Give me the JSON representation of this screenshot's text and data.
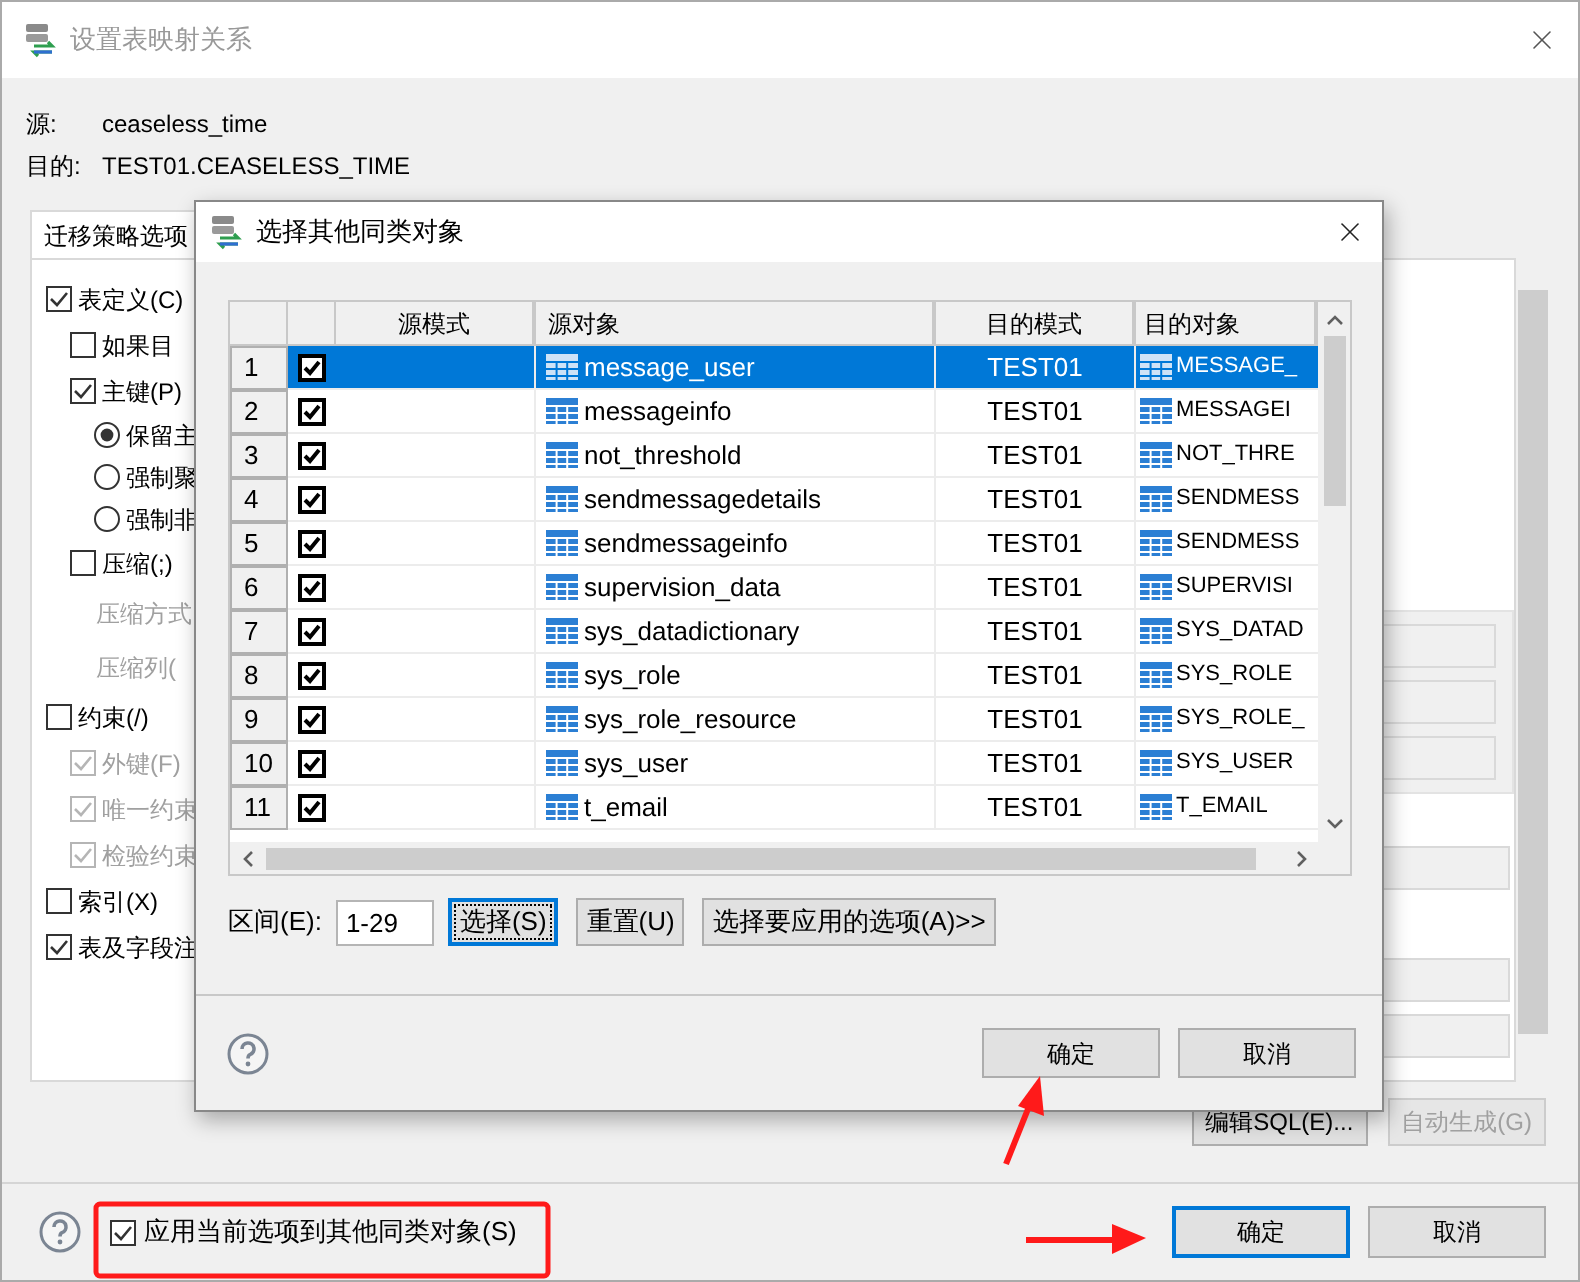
{
  "main_window": {
    "title": "设置表映射关系",
    "source_label": "源:",
    "source_value": "ceaseless_time",
    "target_label": "目的:",
    "target_value": "TEST01.CEASELESS_TIME",
    "tab": {
      "label": "迁移策略选项",
      "selected": true
    },
    "options": [
      {
        "kind": "checkbox",
        "label": "表定义(C)",
        "checked": true,
        "disabled": false,
        "children": [
          {
            "kind": "checkbox",
            "label": "如果目",
            "checked": false,
            "disabled": false
          },
          {
            "kind": "checkbox",
            "label": "主键(P)",
            "checked": true,
            "disabled": false,
            "children": [
              {
                "kind": "radio",
                "label": "保留主",
                "selected": true
              },
              {
                "kind": "radio",
                "label": "强制聚",
                "selected": false
              },
              {
                "kind": "radio",
                "label": "强制非",
                "selected": false
              }
            ]
          },
          {
            "kind": "checkbox",
            "label": "压缩(;)",
            "checked": false,
            "disabled": false,
            "children": [
              {
                "kind": "label",
                "label": "压缩方式",
                "disabled": true
              },
              {
                "kind": "label",
                "label": "压缩列(",
                "disabled": true
              }
            ]
          }
        ]
      },
      {
        "kind": "checkbox",
        "label": "约束(/)",
        "checked": false,
        "disabled": false,
        "children": [
          {
            "kind": "checkbox",
            "label": "外键(F)",
            "checked": true,
            "disabled": true
          },
          {
            "kind": "checkbox",
            "label": "唯一约束",
            "checked": true,
            "disabled": true
          },
          {
            "kind": "checkbox",
            "label": "检验约束",
            "checked": true,
            "disabled": true
          }
        ]
      },
      {
        "kind": "checkbox",
        "label": "索引(X)",
        "checked": false,
        "disabled": false
      },
      {
        "kind": "checkbox",
        "label": "表及字段注",
        "checked": true,
        "disabled": false
      }
    ],
    "buttons": [
      {
        "label": "编辑SQL(E)...",
        "disabled": false
      },
      {
        "label": "自动生成(G)",
        "disabled": true
      }
    ],
    "apply_checkbox": {
      "label": "应用当前选项到其他同类对象(S)",
      "checked": true
    },
    "footer_buttons": [
      {
        "label": "确定",
        "default": true
      },
      {
        "label": "取消",
        "default": false
      }
    ]
  },
  "dialog": {
    "title": "选择其他同类对象",
    "columns": [
      "源模式",
      "源对象",
      "目的模式",
      "目的对象"
    ],
    "rows": [
      {
        "number": "1",
        "checked": true,
        "selected": true,
        "source_object": "message_user",
        "target_schema": "TEST01",
        "target_object": "MESSAGE_"
      },
      {
        "number": "2",
        "checked": true,
        "selected": false,
        "source_object": "messageinfo",
        "target_schema": "TEST01",
        "target_object": "MESSAGEI"
      },
      {
        "number": "3",
        "checked": true,
        "selected": false,
        "source_object": "not_threshold",
        "target_schema": "TEST01",
        "target_object": "NOT_THRE"
      },
      {
        "number": "4",
        "checked": true,
        "selected": false,
        "source_object": "sendmessagedetails",
        "target_schema": "TEST01",
        "target_object": "SENDMESS"
      },
      {
        "number": "5",
        "checked": true,
        "selected": false,
        "source_object": "sendmessageinfo",
        "target_schema": "TEST01",
        "target_object": "SENDMESS"
      },
      {
        "number": "6",
        "checked": true,
        "selected": false,
        "source_object": "supervision_data",
        "target_schema": "TEST01",
        "target_object": "SUPERVISI"
      },
      {
        "number": "7",
        "checked": true,
        "selected": false,
        "source_object": "sys_datadictionary",
        "target_schema": "TEST01",
        "target_object": "SYS_DATAD"
      },
      {
        "number": "8",
        "checked": true,
        "selected": false,
        "source_object": "sys_role",
        "target_schema": "TEST01",
        "target_object": "SYS_ROLE"
      },
      {
        "number": "9",
        "checked": true,
        "selected": false,
        "source_object": "sys_role_resource",
        "target_schema": "TEST01",
        "target_object": "SYS_ROLE_"
      },
      {
        "number": "10",
        "checked": true,
        "selected": false,
        "source_object": "sys_user",
        "target_schema": "TEST01",
        "target_object": "SYS_USER"
      },
      {
        "number": "11",
        "checked": true,
        "selected": false,
        "source_object": "t_email",
        "target_schema": "TEST01",
        "target_object": "T_EMAIL"
      }
    ],
    "range": {
      "label": "区间(E):",
      "value": "1-29"
    },
    "buttons": [
      {
        "label": "选择(S)",
        "focused": true
      },
      {
        "label": "重置(U)",
        "focused": false
      },
      {
        "label": "选择要应用的选项(A)>>",
        "focused": false
      }
    ],
    "footer_buttons": [
      "确定",
      "取消"
    ]
  }
}
